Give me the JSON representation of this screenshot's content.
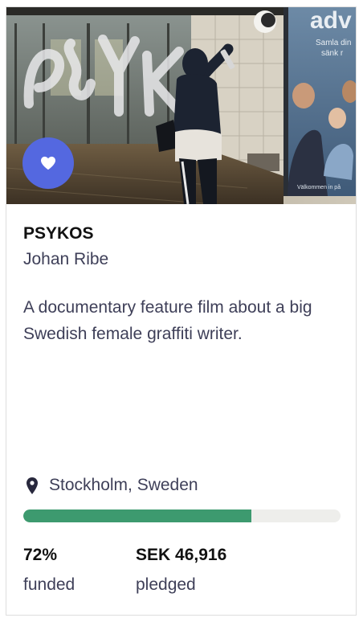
{
  "project": {
    "title": "PSYKOS",
    "creator": "Johan Ribe",
    "blurb": "A documentary feature film about a big Swedish female graffiti writer.",
    "location": "Stockholm, Sweden",
    "image_alt": "graffiti-writer-photo"
  },
  "funding": {
    "percent_value": 72,
    "percent_text": "72%",
    "percent_label": "funded",
    "pledged_text": "SEK 46,916",
    "pledged_label": "pledged"
  },
  "hero_text": {
    "ad_word": "adv",
    "ad_line1": "Samla din",
    "ad_line2": "sänk r",
    "ad_footer": "Välkommen in på"
  },
  "colors": {
    "heart_button": "#5468e0",
    "progress_fill": "#3d9a6f",
    "progress_track": "#eeeeeb"
  },
  "icons": {
    "favorite": "heart-icon",
    "location": "map-pin-icon"
  }
}
